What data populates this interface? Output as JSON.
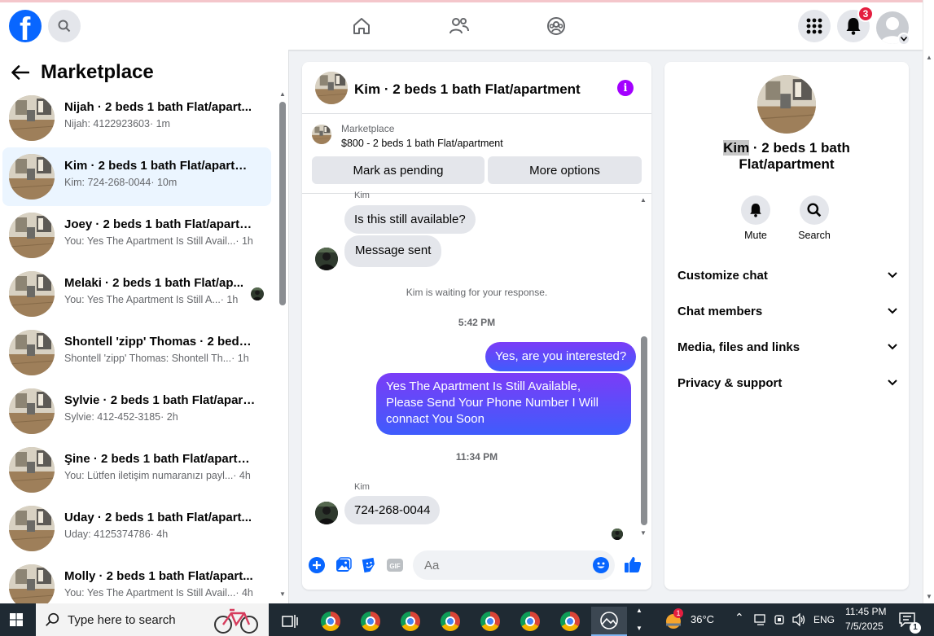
{
  "topbar": {
    "logo_letter": "f",
    "notification_count": "3"
  },
  "left": {
    "title": "Marketplace",
    "conversations": [
      {
        "title": "Nijah · 2 beds 1 bath Flat/apart...",
        "snippet": "Nijah: 4122923603",
        "time": "· 1m",
        "active": false
      },
      {
        "title": "Kim · 2 beds 1 bath Flat/apartme...",
        "snippet": "Kim: 724-268-0044",
        "time": "· 10m",
        "active": true
      },
      {
        "title": "Joey · 2 beds 1 bath Flat/apartm...",
        "snippet": "You: Yes The Apartment Is Still Avail...",
        "time": "· 1h",
        "active": false
      },
      {
        "title": "Melaki · 2 beds 1 bath Flat/ap...",
        "snippet": "You: Yes The Apartment Is Still A...",
        "time": "· 1h",
        "active": false
      },
      {
        "title": "Shontell 'zipp' Thomas · 2 beds ...",
        "snippet": "Shontell 'zipp' Thomas: Shontell Th...",
        "time": "· 1h",
        "active": false
      },
      {
        "title": "Sylvie · 2 beds 1 bath Flat/apart...",
        "snippet": "Sylvie: 412-452-3185",
        "time": "· 2h",
        "active": false
      },
      {
        "title": "Şine · 2 beds 1 bath Flat/apartm...",
        "snippet": "You: Lütfen iletişim numaranızı payl...",
        "time": "· 4h",
        "active": false
      },
      {
        "title": "Uday · 2 beds 1 bath Flat/apart...",
        "snippet": "Uday: 4125374786",
        "time": "· 4h",
        "active": false
      },
      {
        "title": "Molly · 2 beds 1 bath Flat/apart...",
        "snippet": "You: Yes The Apartment Is Still Avail...",
        "time": "· 4h",
        "active": false
      }
    ]
  },
  "chat": {
    "header_name": "Kim · 2 beds 1 bath Flat/apartment",
    "listing_label": "Marketplace",
    "listing_price": "$800 - 2 beds 1 bath Flat/apartment",
    "mark_pending": "Mark as pending",
    "more_options": "More options",
    "sender_top": "Kim",
    "msg1": "Is this still available?",
    "msg2": "Message sent",
    "waiting": "Kim is waiting for your response.",
    "time1": "5:42 PM",
    "out1": "Yes, are you interested?",
    "out2": "Yes The Apartment Is Still Available, Please Send Your Phone Number I Will connact You Soon",
    "time2": "11:34 PM",
    "sender_bottom": "Kim",
    "msg3": "724-268-0044",
    "composer_placeholder": "Aa"
  },
  "right": {
    "title_name": "Kim",
    "title_rest": " · 2 beds 1 bath Flat/apartment",
    "mute": "Mute",
    "search": "Search",
    "sections": [
      "Customize chat",
      "Chat members",
      "Media, files and links",
      "Privacy & support"
    ]
  },
  "taskbar": {
    "search_placeholder": "Type here to search",
    "weather_temp": "36°C",
    "weather_badge": "1",
    "language": "ENG",
    "time": "11:45 PM",
    "date": "7/5/2025",
    "notification_count": "1"
  },
  "colors": {
    "brand": "#0866ff",
    "outgoing_bubble": "#5b4bf9",
    "badge": "#e41e3f"
  }
}
